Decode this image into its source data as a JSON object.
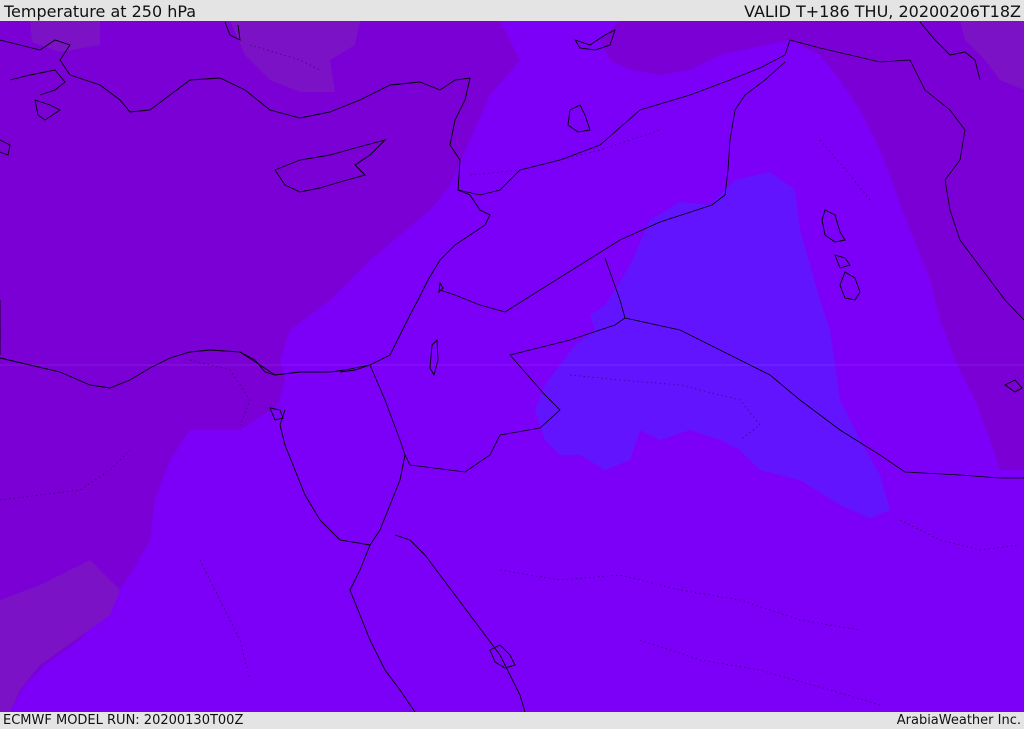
{
  "header": {
    "title": "Temperature at 250 hPa",
    "valid_time": "VALID T+186 THU, 20200206T18Z"
  },
  "footer": {
    "model_run": "ECMWF MODEL RUN: 20200130T00Z",
    "credit": "ArabiaWeather Inc."
  },
  "colors": {
    "background_frame": "#e4e4e4",
    "field_warm": "#7a00d6",
    "field_warmer": "#7c12c6",
    "field_mid": "#7c00f8",
    "field_cold": "#6314ff",
    "coastline": "#000000",
    "contour": "#000000"
  },
  "map": {
    "region": "Eastern Mediterranean / Middle East",
    "projection": "cylindrical"
  }
}
